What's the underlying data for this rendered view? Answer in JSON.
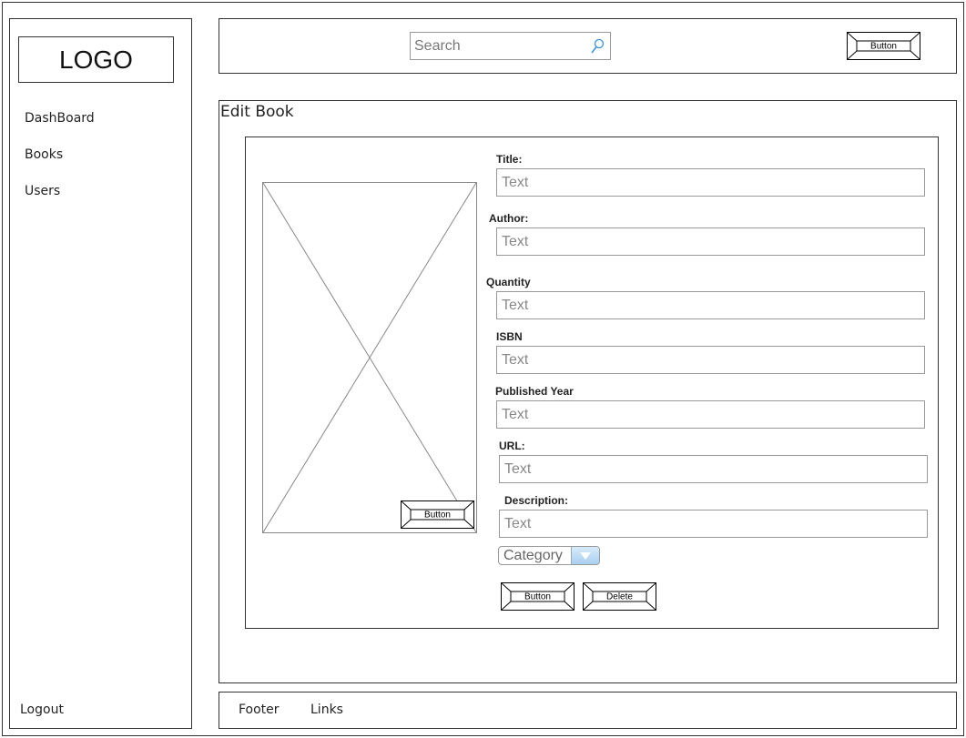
{
  "sidebar": {
    "logo": "LOGO",
    "items": [
      {
        "label": "DashBoard"
      },
      {
        "label": "Books"
      },
      {
        "label": "Users"
      }
    ],
    "logout": "Logout"
  },
  "header": {
    "search_placeholder": "Search",
    "button_label": "Button"
  },
  "main": {
    "title": "Edit Book",
    "image_button_label": "Button",
    "form": {
      "fields": [
        {
          "label": "Title:",
          "placeholder": "Text"
        },
        {
          "label": "Author:",
          "placeholder": "Text"
        },
        {
          "label": "Quantity",
          "placeholder": "Text"
        },
        {
          "label": "ISBN",
          "placeholder": "Text"
        },
        {
          "label": "Published Year",
          "placeholder": "Text"
        },
        {
          "label": "URL:",
          "placeholder": "Text"
        },
        {
          "label": "Description:",
          "placeholder": "Text"
        }
      ],
      "category_label": "Category",
      "primary_button_label": "Button",
      "delete_button_label": "Delete"
    }
  },
  "footer": {
    "links": [
      "Footer",
      "Links"
    ]
  }
}
